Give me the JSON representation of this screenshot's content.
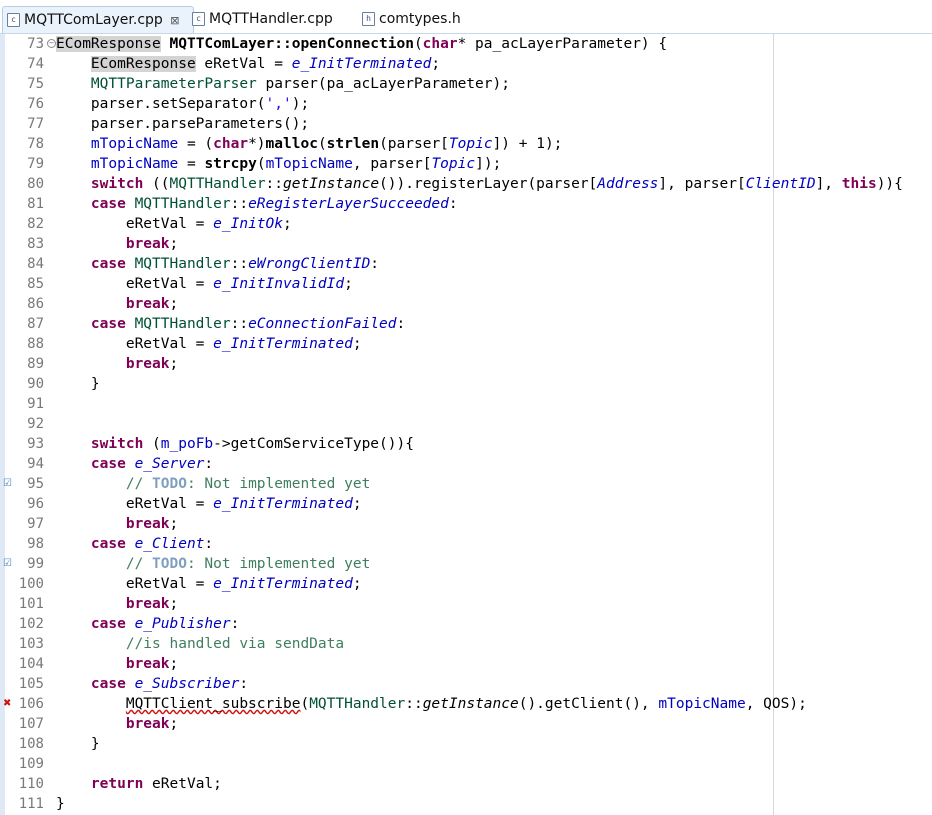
{
  "tabs": [
    {
      "label": "MQTTComLayer.cpp",
      "icon": "cpp-file-icon",
      "icon_glyph": "c",
      "active": true,
      "close_glyph": "⊠"
    },
    {
      "label": "MQTTHandler.cpp",
      "icon": "cpp-file-icon",
      "icon_glyph": "c",
      "active": false
    },
    {
      "label": "comtypes.h",
      "icon": "header-file-icon",
      "icon_glyph": "h",
      "active": false
    }
  ],
  "editor": {
    "line_numbers": [
      "73",
      "74",
      "75",
      "76",
      "77",
      "78",
      "79",
      "80",
      "81",
      "82",
      "83",
      "84",
      "85",
      "86",
      "87",
      "88",
      "89",
      "90",
      "91",
      "92",
      "93",
      "94",
      "95",
      "96",
      "97",
      "98",
      "99",
      "100",
      "101",
      "102",
      "103",
      "104",
      "105",
      "106",
      "107",
      "108",
      "109",
      "110",
      "111"
    ],
    "fold_glyph": "−",
    "marker_glyphs": {
      "task": "☑",
      "error": "✖"
    },
    "tokens": [
      [
        "EComResponse",
        " ",
        "MQTTComLayer::openConnection",
        "(",
        "char",
        "* pa_acLayerParameter) {"
      ],
      [
        "EComResponse",
        " eRetVal = ",
        "e_InitTerminated",
        ";"
      ],
      [
        "MQTTParameterParser",
        " parser(pa_acLayerParameter);"
      ],
      [
        "parser.setSeparator(",
        "','",
        ");"
      ],
      [
        "parser.parseParameters();"
      ],
      [
        "mTopicName",
        " = (",
        "char",
        "*)",
        "malloc",
        "(",
        "strlen",
        "(parser[",
        "Topic",
        "]) + 1);"
      ],
      [
        "mTopicName",
        " = ",
        "strcpy",
        "(",
        "mTopicName",
        ", parser[",
        "Topic",
        "]);"
      ],
      [
        "switch",
        " ((",
        "MQTTHandler",
        "::",
        "getInstance",
        "()).registerLayer(parser[",
        "Address",
        "], parser[",
        "ClientID",
        "], ",
        "this",
        ")){"
      ],
      [
        "case",
        " ",
        "MQTTHandler",
        "::",
        "eRegisterLayerSucceeded",
        ":"
      ],
      [
        "eRetVal = ",
        "e_InitOk",
        ";"
      ],
      [
        "break",
        ";"
      ],
      [
        "case",
        " ",
        "MQTTHandler",
        "::",
        "eWrongClientID",
        ":"
      ],
      [
        "eRetVal = ",
        "e_InitInvalidId",
        ";"
      ],
      [
        "break",
        ";"
      ],
      [
        "case",
        " ",
        "MQTTHandler",
        "::",
        "eConnectionFailed",
        ":"
      ],
      [
        "eRetVal = ",
        "e_InitTerminated",
        ";"
      ],
      [
        "break",
        ";"
      ],
      [
        "}"
      ],
      [
        ""
      ],
      [
        ""
      ],
      [
        "switch",
        " (",
        "m_poFb",
        "->getComServiceType()){"
      ],
      [
        "case",
        " ",
        "e_Server",
        ":"
      ],
      [
        "// ",
        "TODO",
        ": Not implemented yet"
      ],
      [
        "eRetVal = ",
        "e_InitTerminated",
        ";"
      ],
      [
        "break",
        ";"
      ],
      [
        "case",
        " ",
        "e_Client",
        ":"
      ],
      [
        "// ",
        "TODO",
        ": Not implemented yet"
      ],
      [
        "eRetVal = ",
        "e_InitTerminated",
        ";"
      ],
      [
        "break",
        ";"
      ],
      [
        "case",
        " ",
        "e_Publisher",
        ":"
      ],
      [
        "//is handled via sendData"
      ],
      [
        "break",
        ";"
      ],
      [
        "case",
        " ",
        "e_Subscriber",
        ":"
      ],
      [
        "MQTTClient_subscribe",
        "(",
        "MQTTHandler",
        "::",
        "getInstance",
        "().getClient(), ",
        "mTopicName",
        ", QOS);"
      ],
      [
        "break",
        ";"
      ],
      [
        "}"
      ],
      [
        ""
      ],
      [
        "return",
        " eRetVal;"
      ],
      [
        "}"
      ]
    ]
  },
  "colors": {
    "keyword": "#7f0055",
    "type": "#005032",
    "field": "#0000c0",
    "comment": "#3f7f5f",
    "todo": "#7f9fbf",
    "string": "#2a00ff",
    "line_number": "#787878",
    "overview_strip": "#dfe9f6",
    "error_marker": "#d01010",
    "task_marker": "#4a7fc0"
  }
}
